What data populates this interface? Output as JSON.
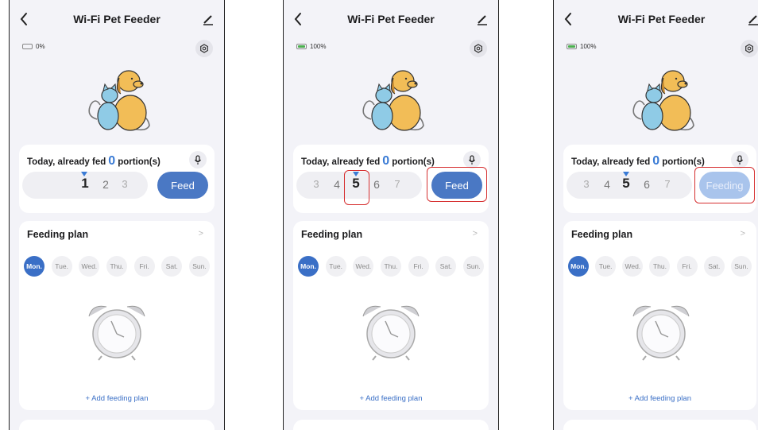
{
  "screens": [
    {
      "title": "Wi-Fi Pet Feeder",
      "battery": "0%",
      "battery_level": 0,
      "fed_prefix": "Today, already fed",
      "fed_count": "0",
      "fed_suffix": "portion(s)",
      "picker": [
        "1",
        "2",
        "3"
      ],
      "selected": "1",
      "feed_button": "Feed",
      "feed_button_state": "enabled",
      "plan_title": "Feeding plan",
      "days": [
        "Mon.",
        "Tue.",
        "Wed.",
        "Thu.",
        "Fri.",
        "Sat.",
        "Sun."
      ],
      "active_day": "Mon.",
      "add_plan": "+ Add feeding plan"
    },
    {
      "title": "Wi-Fi Pet Feeder",
      "battery": "100%",
      "battery_level": 100,
      "fed_prefix": "Today, already fed",
      "fed_count": "0",
      "fed_suffix": "portion(s)",
      "picker": [
        "3",
        "4",
        "5",
        "6",
        "7"
      ],
      "selected": "5",
      "feed_button": "Feed",
      "feed_button_state": "enabled",
      "plan_title": "Feeding plan",
      "days": [
        "Mon.",
        "Tue.",
        "Wed.",
        "Thu.",
        "Fri.",
        "Sat.",
        "Sun."
      ],
      "active_day": "Mon.",
      "add_plan": "+ Add feeding plan"
    },
    {
      "title": "Wi-Fi Pet Feeder",
      "battery": "100%",
      "battery_level": 100,
      "fed_prefix": "Today, already fed",
      "fed_count": "0",
      "fed_suffix": "portion(s)",
      "picker": [
        "3",
        "4",
        "5",
        "6",
        "7"
      ],
      "selected": "5",
      "feed_button": "Feeding",
      "feed_button_state": "disabled",
      "plan_title": "Feeding plan",
      "days": [
        "Mon.",
        "Tue.",
        "Wed.",
        "Thu.",
        "Fri.",
        "Sat.",
        "Sun."
      ],
      "active_day": "Mon.",
      "add_plan": "+ Add feeding plan"
    }
  ],
  "colors": {
    "accent": "#3a6fc6",
    "highlight": "#d63031",
    "battery_ok": "#4caf50"
  }
}
